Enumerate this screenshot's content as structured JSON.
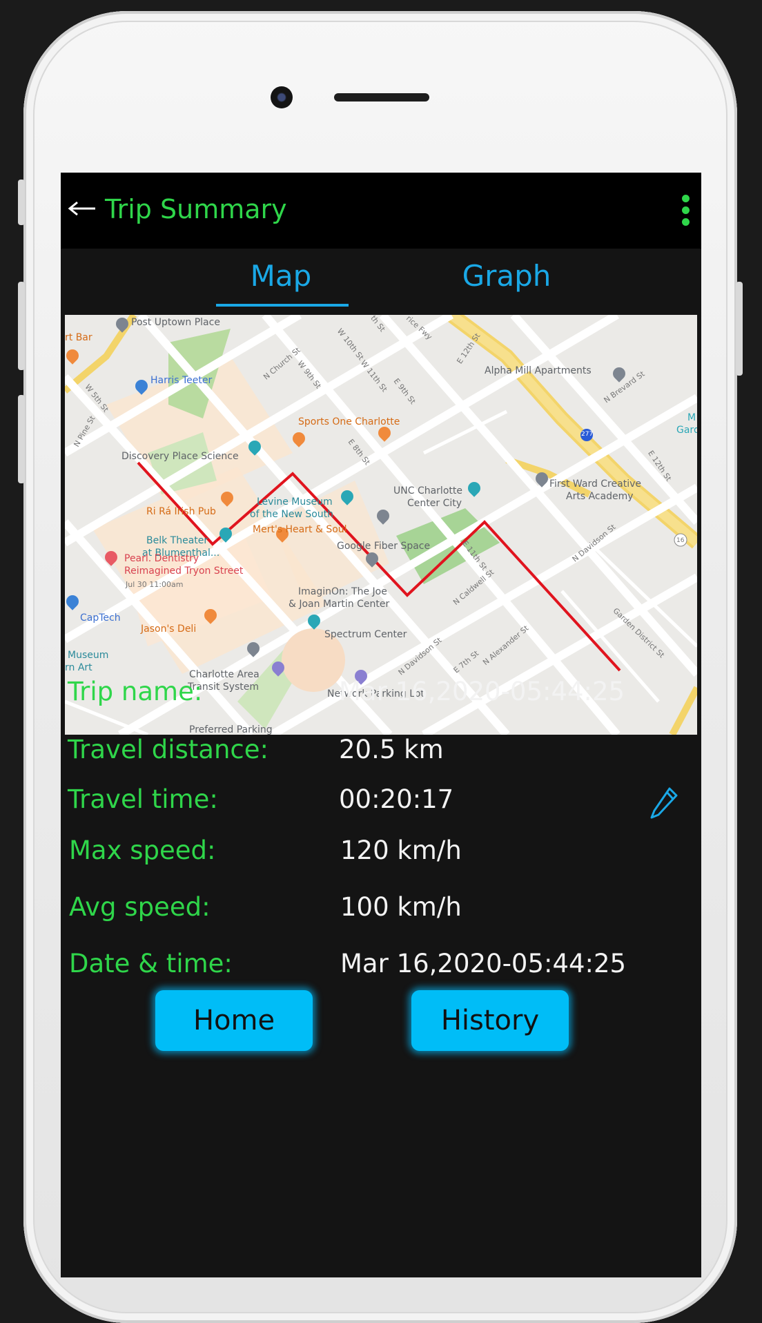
{
  "appbar": {
    "title": "Trip Summary"
  },
  "tabs": [
    {
      "label": "Map",
      "active": true
    },
    {
      "label": "Graph",
      "active": false
    }
  ],
  "colors": {
    "accent_green": "#2fd64a",
    "accent_blue": "#1aa8e6",
    "button_blue": "#00bdf7",
    "route_red": "#e0141e"
  },
  "map": {
    "labels": {
      "post_uptown": "Post Uptown Place",
      "rt_bar": "rt Bar",
      "harris_teeter": "Harris Teeter",
      "discovery": "Discovery Place Science",
      "sports_one": "Sports One Charlotte",
      "alpha_mill": "Alpha Mill Apartments",
      "first_ward_1": "First Ward Creative",
      "first_ward_2": "Arts Academy",
      "unc_1": "UNC Charlotte",
      "unc_2": "Center City",
      "levine_1": "Levine Museum",
      "levine_2": "of the New South",
      "merts": "Mert's Heart & Soul",
      "ri_ra": "Ri Rá Irish Pub",
      "belk_1": "Belk Theater",
      "belk_2": "at Blumenthal...",
      "google_fiber": "Google Fiber Space",
      "pearl_1": "Pearl. Dentistry",
      "pearl_2": "Reimagined Tryon Street",
      "pearl_3": "Jul 30 11:00am",
      "imaginon_1": "ImaginOn: The Joe",
      "imaginon_2": "& Joan Martin Center",
      "captech": "CapTech",
      "jasons": "Jason's Deli",
      "spectrum": "Spectrum Center",
      "museum_1": "Museum",
      "museum_2": "rn Art",
      "transit_1": "Charlotte Area",
      "transit_2": "Transit System",
      "preferred": "Preferred Parking",
      "network_parking": "Network Parking Lot",
      "gard_1": "M",
      "gard_2": "Gard",
      "n_church": "N Church St",
      "w_5th": "W 5th St",
      "n_pine": "N Pine St",
      "e_12th": "E 12th St",
      "e_12th_b": "E 12th St",
      "n_brevard": "N Brevard St",
      "n_caldwell": "N Caldwell St",
      "n_davidson": "N Davidson St",
      "n_davidson_b": "N Davidson St",
      "e_7th": "E 7th St",
      "n_alexander": "N Alexander St",
      "garden_district": "Garden District St",
      "e_8th": "E 8th St",
      "e_9th": "E 9th St",
      "e_11th": "E 11th St",
      "w_10th": "W 10th St",
      "w_11th": "W 11th St",
      "w_9th": "W 9th St",
      "hwy_277": "277",
      "hwy_16": "16",
      "hwy_fwy": "rice Fwy",
      "th_st": "th St"
    }
  },
  "details": {
    "trip_name": {
      "label": "Trip name:",
      "value": "Mar 16,2020-05:44:25"
    },
    "travel_distance": {
      "label": "Travel distance:",
      "value": "20.5 km"
    },
    "travel_time": {
      "label": "Travel time:",
      "value": "00:20:17"
    },
    "max_speed": {
      "label": "Max speed:",
      "value": "120 km/h"
    },
    "avg_speed": {
      "label": "Avg speed:",
      "value": "100 km/h"
    },
    "date_time": {
      "label": "Date & time:",
      "value": "Mar 16,2020-05:44:25"
    }
  },
  "buttons": {
    "home": "Home",
    "history": "History"
  }
}
